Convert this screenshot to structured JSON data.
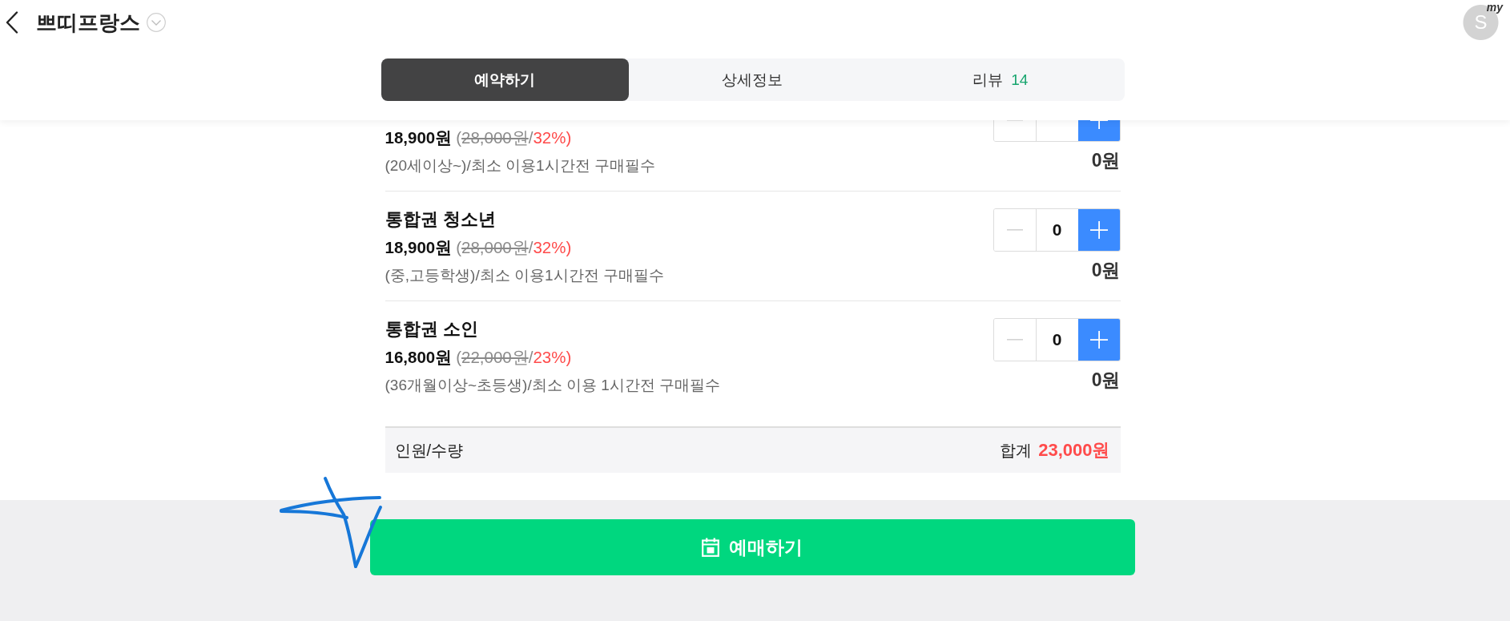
{
  "header": {
    "title": "쁘띠프랑스",
    "avatar": {
      "initial": "S",
      "badge": "my"
    }
  },
  "tabs": [
    {
      "label": "예약하기",
      "selected": true
    },
    {
      "label": "상세정보",
      "selected": false
    },
    {
      "label": "리뷰",
      "count": "14",
      "selected": false
    }
  ],
  "tickets": [
    {
      "price": "18,900원",
      "price_note": [
        {
          "kind": "plain",
          "text": "("
        },
        {
          "kind": "struck",
          "text": "28,000원"
        },
        {
          "kind": "plain",
          "text": "/"
        },
        {
          "kind": "discount",
          "text": "32%)"
        }
      ],
      "description": "(20세이상~)/최소 이용1시간전 구매필수",
      "decrease_disabled": true,
      "subtotal": "0원"
    },
    {
      "name": "통합권 청소년",
      "price": "18,900원",
      "price_note": [
        {
          "kind": "plain",
          "text": "("
        },
        {
          "kind": "struck",
          "text": "28,000원"
        },
        {
          "kind": "plain",
          "text": "/"
        },
        {
          "kind": "discount",
          "text": "32%)"
        }
      ],
      "description": "(중,고등학생)/최소 이용1시간전 구매필수",
      "quantity": "0",
      "decrease_disabled": true,
      "subtotal": "0원"
    },
    {
      "name": "통합권 소인",
      "price": "16,800원",
      "price_note": [
        {
          "kind": "plain",
          "text": "("
        },
        {
          "kind": "struck",
          "text": "22,000원"
        },
        {
          "kind": "plain",
          "text": "/"
        },
        {
          "kind": "discount",
          "text": "23%)"
        }
      ],
      "description": "(36개월이상~초등생)/최소 이용 1시간전 구매필수",
      "quantity": "0",
      "decrease_disabled": true,
      "subtotal": "0원"
    }
  ],
  "summary": {
    "label": "인원/수량",
    "total_label": "합계",
    "total": "23,000원"
  },
  "book_button": {
    "label": "예매하기"
  }
}
